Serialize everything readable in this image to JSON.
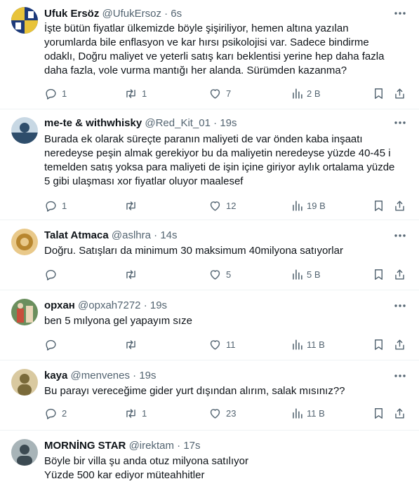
{
  "tweets": [
    {
      "name": "Ufuk Ersöz",
      "handle": "@UfukErsoz",
      "dot": "·",
      "time": "6s",
      "text": "İşte bütün fiyatlar ülkemizde böyle şişiriliyor, hemen altına yazılan\nyorumlarda bile enflasyon ve kar hırsı psikolojisi var. Sadece bindirme\nodaklı, Doğru maliyet ve yeterli satış karı beklentisi yerine hep daha fazla\ndaha fazla, vole vurma mantığı her alanda. Sürümden kazanma?",
      "replies": "1",
      "retweets": "1",
      "likes": "7",
      "views": "2 B",
      "avatar_colors": [
        "#1d3a7a",
        "#e8c33a"
      ]
    },
    {
      "name": "me-te & withwhisky",
      "handle": "@Red_Kit_01",
      "dot": "·",
      "time": "19s",
      "text": "Burada ek olarak süreçte paranın maliyeti de var önden kaba inşaatı\nneredeyse peşin almak gerekiyor bu da maliyetin neredeyse yüzde 40-45 i\ntemelden satış yoksa para maliyeti de işin içine giriyor aylık ortalama yüzde\n5 gibi ulaşması xor fiyatlar oluyor maalesef",
      "replies": "1",
      "retweets": "",
      "likes": "12",
      "views": "19 B",
      "avatar_colors": [
        "#2e4d6b",
        "#c8d8e4"
      ]
    },
    {
      "name": "Talat Atmaca",
      "handle": "@aslhra",
      "dot": "·",
      "time": "14s",
      "text": "Doğru. Satışları da minimum 30 maksimum 40milyona satıyorlar",
      "replies": "",
      "retweets": "",
      "likes": "5",
      "views": "5 B",
      "avatar_colors": [
        "#b8862e",
        "#e9c98a"
      ]
    },
    {
      "name": "орхан",
      "handle": "@opxah7272",
      "dot": "·",
      "time": "19s",
      "text": "ben 5 mılyona gel yapayım sıze",
      "replies": "",
      "retweets": "",
      "likes": "11",
      "views": "11 B",
      "avatar_colors": [
        "#6b8f5e",
        "#c94e3c"
      ]
    },
    {
      "name": "kaya",
      "handle": "@menvenes",
      "dot": "·",
      "time": "19s",
      "text": "Bu parayı vereceğime gider yurt dışından alırım, salak mısınız??",
      "replies": "2",
      "retweets": "1",
      "likes": "23",
      "views": "11 B",
      "avatar_colors": [
        "#7a6a3a",
        "#d9c9a0"
      ]
    },
    {
      "name": "MORNİNG STAR",
      "handle": "@irektam",
      "dot": "·",
      "time": "17s",
      "text": "Böyle bir villa şu anda otuz milyona satılıyor\nYüzde 500 kar ediyor müteahhitler",
      "avatar_colors": [
        "#3c4a52",
        "#a8b4b8"
      ]
    }
  ]
}
